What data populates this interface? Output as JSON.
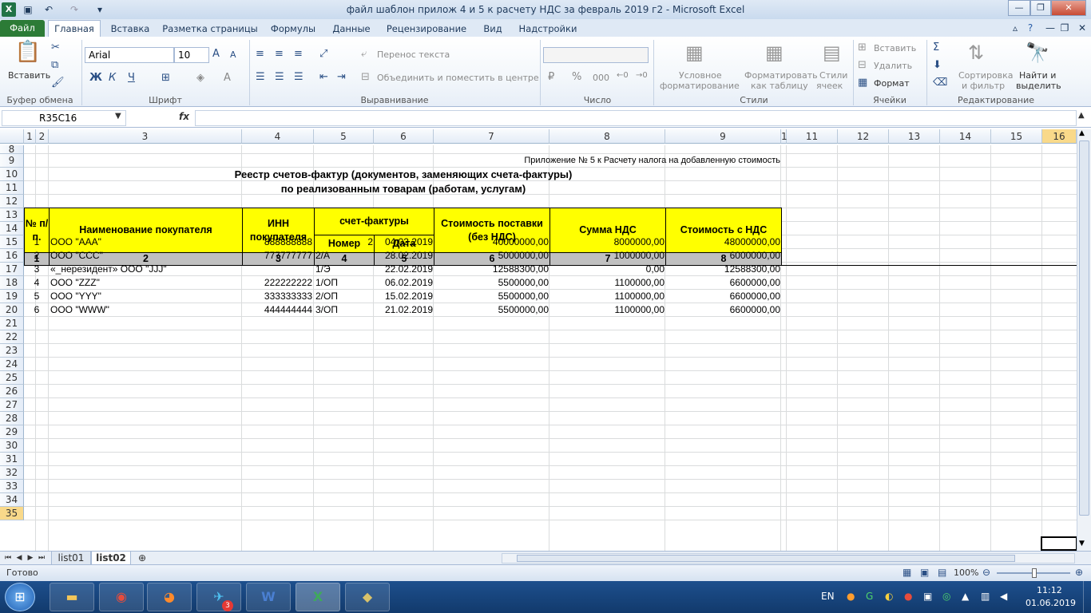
{
  "window": {
    "title": "файл шаблон прилож 4 и 5 к расчету НДС за февраль 2019 г2  -  Microsoft Excel"
  },
  "tabs": [
    "Файл",
    "Главная",
    "Вставка",
    "Разметка страницы",
    "Формулы",
    "Данные",
    "Рецензирование",
    "Вид",
    "Надстройки"
  ],
  "ribbon": {
    "paste": "Вставить",
    "clipboard": "Буфер обмена",
    "font_name": "Arial",
    "font_size": "10",
    "font_group": "Шрифт",
    "wrap_text": "Перенос текста",
    "merge_center": "Объединить и поместить в центре",
    "alignment_group": "Выравнивание",
    "number_group": "Число",
    "conditional_formatting_1": "Условное",
    "conditional_formatting_2": "форматирование",
    "format_as_table_1": "Форматировать",
    "format_as_table_2": "как таблицу",
    "cell_styles_1": "Стили",
    "cell_styles_2": "ячеек",
    "styles_group": "Стили",
    "insert": "Вставить",
    "delete": "Удалить",
    "format": "Формат",
    "cells_group": "Ячейки",
    "sort_filter_1": "Сортировка",
    "sort_filter_2": "и фильтр",
    "find_select_1": "Найти и",
    "find_select_2": "выделить",
    "editing_group": "Редактирование"
  },
  "formula_bar": {
    "name_box": "R35C16",
    "fx": "fx",
    "value": ""
  },
  "columns": [
    "1",
    "2",
    "3",
    "4",
    "5",
    "6",
    "7",
    "8",
    "9",
    "1",
    "11",
    "12",
    "13",
    "14",
    "15",
    "16"
  ],
  "rows": [
    "8",
    "9",
    "10",
    "11",
    "12",
    "13",
    "14",
    "15",
    "16",
    "17",
    "18",
    "19",
    "20",
    "21",
    "22",
    "23",
    "24",
    "25",
    "26",
    "27",
    "28",
    "29",
    "30",
    "31",
    "32",
    "33",
    "34",
    "35"
  ],
  "sheet": {
    "appendix_note": "Приложение № 5 к Расчету налога на добавленную стоимость",
    "title_line1": "Реестр счетов-фактур (документов, заменяющих счета-фактуры)",
    "title_line2": "по реализованным товарам (работам, услугам)",
    "headers": {
      "num": "№ п/п.",
      "buyer": "Наименование покупателя",
      "inn": "ИНН покупателя",
      "invoice": "счет-фактуры",
      "invoice_num": "Номер",
      "invoice_date": "Дата",
      "cost_no_vat": "Стоимость поставки (без НДС)",
      "vat": "Сумма НДС",
      "cost_with_vat": "Стоимость с НДС"
    },
    "col_numbers": [
      "1",
      "2",
      "3",
      "4",
      "5",
      "6",
      "7",
      "8"
    ],
    "data_rows": [
      {
        "n": "1",
        "buyer": "ООО \"ААА\"",
        "inn": "888888888",
        "num": "2",
        "date": "04.02.2019",
        "cost": "40000000,00",
        "vat": "8000000,00",
        "total": "48000000,00"
      },
      {
        "n": "2",
        "buyer": "ООО \"ССС\"",
        "inn": "777777777",
        "num": "2/А",
        "date": "28.02.2019",
        "cost": "5000000,00",
        "vat": "1000000,00",
        "total": "6000000,00"
      },
      {
        "n": "3",
        "buyer": "«_нерезидент» ООО \"JJJ\"",
        "inn": "",
        "num": "1/Э",
        "date": "22.02.2019",
        "cost": "12588300,00",
        "vat": "0,00",
        "total": "12588300,00"
      },
      {
        "n": "4",
        "buyer": "ООО \"ZZZ\"",
        "inn": "222222222",
        "num": "1/ОП",
        "date": "06.02.2019",
        "cost": "5500000,00",
        "vat": "1100000,00",
        "total": "6600000,00"
      },
      {
        "n": "5",
        "buyer": "ООО \"YYY\"",
        "inn": "333333333",
        "num": "2/ОП",
        "date": "15.02.2019",
        "cost": "5500000,00",
        "vat": "1100000,00",
        "total": "6600000,00"
      },
      {
        "n": "6",
        "buyer": "ООО \"WWW\"",
        "inn": "444444444",
        "num": "3/ОП",
        "date": "21.02.2019",
        "cost": "5500000,00",
        "vat": "1100000,00",
        "total": "6600000,00"
      }
    ]
  },
  "sheet_tabs": [
    "list01",
    "list02"
  ],
  "status": {
    "ready": "Готово",
    "zoom": "100%"
  },
  "taskbar": {
    "lang": "EN",
    "time": "11:12",
    "date": "01.06.2019",
    "telegram_badge": "3"
  }
}
